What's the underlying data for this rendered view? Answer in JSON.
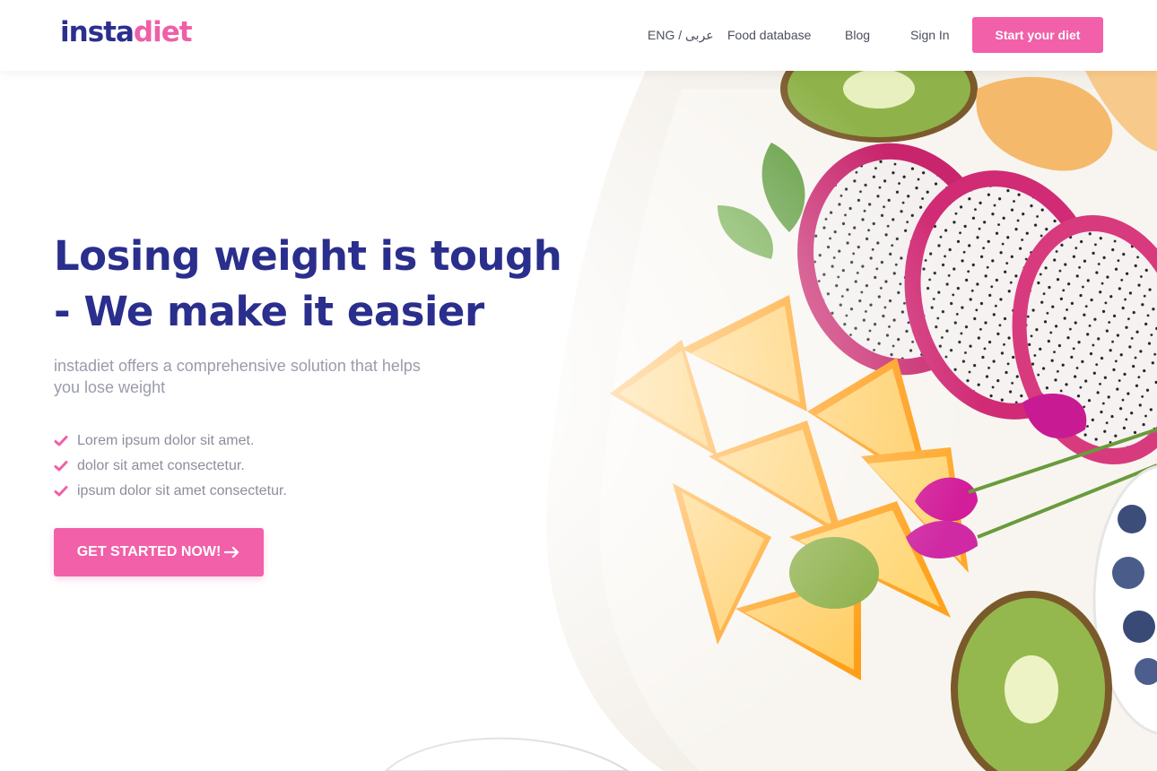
{
  "header": {
    "logo": {
      "part1": "insta",
      "part2": "diet"
    },
    "nav": {
      "language": "ENG / عربى",
      "food_database": "Food database",
      "blog": "Blog",
      "sign_in": "Sign In"
    },
    "cta_label": "Start your diet"
  },
  "hero": {
    "headline_line1": "Losing weight is tough",
    "headline_line2": "- We make it easier",
    "subtext": "instadiet offers a comprehensive solution that helps you lose weight",
    "bullets": [
      "Lorem ipsum dolor sit amet.",
      "dolor sit amet consectetur.",
      "ipsum dolor sit amet consectetur."
    ],
    "cta_label": "GET STARTED NOW!",
    "cta_icon": "arrow-right-icon",
    "bullet_icon": "check-icon",
    "image": "fruit-plate-photo"
  },
  "colors": {
    "brand_blue": "#2a2e8c",
    "brand_pink": "#f160a8",
    "text_muted": "#9a9cab"
  }
}
